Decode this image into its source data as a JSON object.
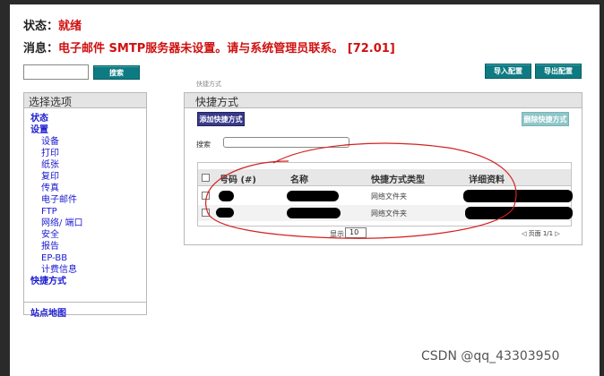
{
  "header": {
    "status_label": "状态：",
    "status_value": "就绪",
    "message_label": "消息：",
    "message_value": "电子邮件 SMTP服务器未设置。请与系统管理员联系。 [72.01]"
  },
  "toolbar": {
    "search_label": "搜索",
    "import_label": "导入配置",
    "export_label": "导出配置"
  },
  "sidebar": {
    "title": "选择选项",
    "items": [
      {
        "label": "状态",
        "level": 0
      },
      {
        "label": "设置",
        "level": 0
      },
      {
        "label": "设备",
        "level": 1
      },
      {
        "label": "打印",
        "level": 1
      },
      {
        "label": "纸张",
        "level": 1
      },
      {
        "label": "复印",
        "level": 1
      },
      {
        "label": "传真",
        "level": 1
      },
      {
        "label": "电子邮件",
        "level": 1
      },
      {
        "label": "FTP",
        "level": 1
      },
      {
        "label": "网络/ 端口",
        "level": 1
      },
      {
        "label": "安全",
        "level": 1
      },
      {
        "label": "报告",
        "level": 1
      },
      {
        "label": "EP-BB",
        "level": 1
      },
      {
        "label": "计费信息",
        "level": 1
      },
      {
        "label": "快捷方式",
        "level": 0
      }
    ],
    "sitemap": "站点地图"
  },
  "breadcrumb": "快捷方式",
  "panel": {
    "title": "快捷方式",
    "add_button": "添加快捷方式",
    "delete_button": "删除快捷方式",
    "filter_label": "搜索",
    "filter_value": ""
  },
  "table": {
    "columns": [
      "号码 (#)",
      "名称",
      "快捷方式类型",
      "详细资料"
    ],
    "rows": [
      {
        "type": "网络文件夹"
      },
      {
        "type": "网络文件夹"
      }
    ]
  },
  "pager": {
    "show_label": "显示",
    "page_size": "10",
    "page_text": "页面 1/1"
  },
  "watermark": "CSDN @qq_43303950",
  "colors": {
    "accent_teal": "#0e7b82",
    "accent_navy": "#3a3a8a",
    "status_red": "#d01010",
    "link_blue": "#1a1ad0"
  }
}
